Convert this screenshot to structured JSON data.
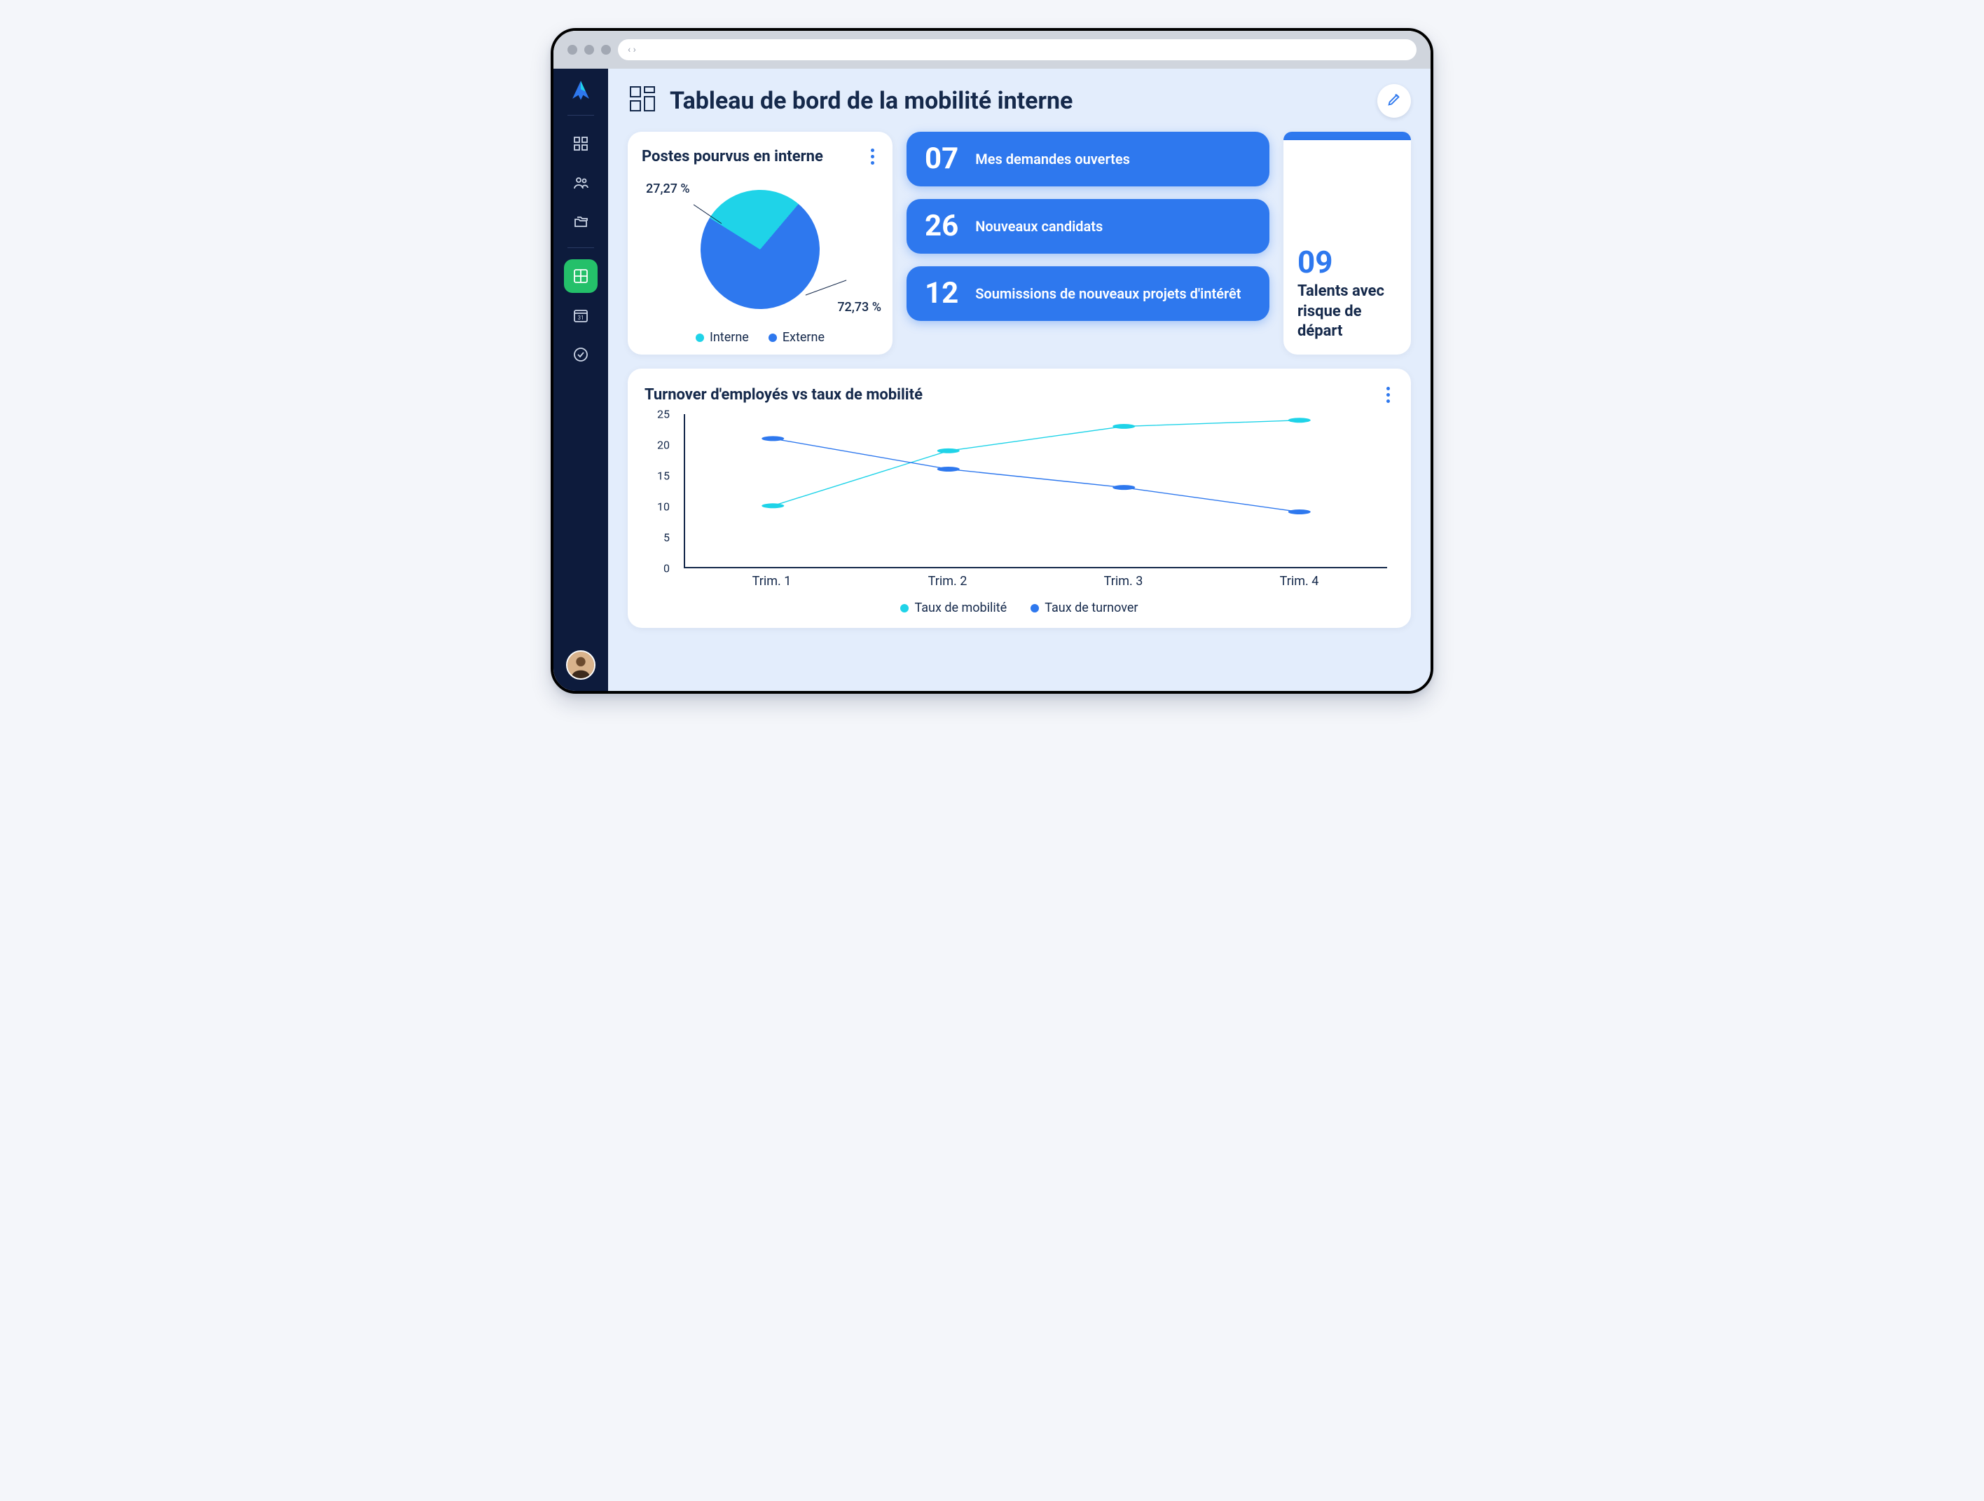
{
  "browser": {
    "nav_glyph": "‹ ›"
  },
  "header": {
    "title": "Tableau de bord de la mobilité interne"
  },
  "pie": {
    "title": "Postes pourvus en interne",
    "label_small": "27,27 %",
    "label_large": "72,73 %",
    "legend_a": "Interne",
    "legend_b": "Externe"
  },
  "metrics": {
    "m1": {
      "value": "07",
      "label": "Mes demandes ouvertes"
    },
    "m2": {
      "value": "26",
      "label": "Nouveaux candidats"
    },
    "m3": {
      "value": "12",
      "label": "Soumissions de nouveaux projets d'intérêt"
    }
  },
  "risk": {
    "value": "09",
    "label": "Talents avec risque de départ"
  },
  "line": {
    "title": "Turnover d'employés vs taux de mobilité",
    "legend_a": "Taux de mobilité",
    "legend_b": "Taux de turnover",
    "y": {
      "t0": "0",
      "t5": "5",
      "t10": "10",
      "t15": "15",
      "t20": "20",
      "t25": "25"
    },
    "x": {
      "c1": "Trim. 1",
      "c2": "Trim. 2",
      "c3": "Trim. 3",
      "c4": "Trim. 4"
    }
  },
  "colors": {
    "blue": "#2e78ee",
    "cyan": "#1fd3e8",
    "navy": "#0d1b3c",
    "green": "#24c06a"
  },
  "chart_data": [
    {
      "type": "pie",
      "title": "Postes pourvus en interne",
      "series": [
        {
          "name": "Interne",
          "value": 27.27,
          "color": "#1fd3e8"
        },
        {
          "name": "Externe",
          "value": 72.73,
          "color": "#2e78ee"
        }
      ]
    },
    {
      "type": "line",
      "title": "Turnover d'employés vs taux de mobilité",
      "xlabel": "",
      "ylabel": "",
      "ylim": [
        0,
        25
      ],
      "categories": [
        "Trim. 1",
        "Trim. 2",
        "Trim. 3",
        "Trim. 4"
      ],
      "series": [
        {
          "name": "Taux de mobilité",
          "color": "#1fd3e8",
          "values": [
            10,
            19,
            23,
            24
          ]
        },
        {
          "name": "Taux de turnover",
          "color": "#2e78ee",
          "values": [
            21,
            16,
            13,
            9
          ]
        }
      ]
    }
  ]
}
